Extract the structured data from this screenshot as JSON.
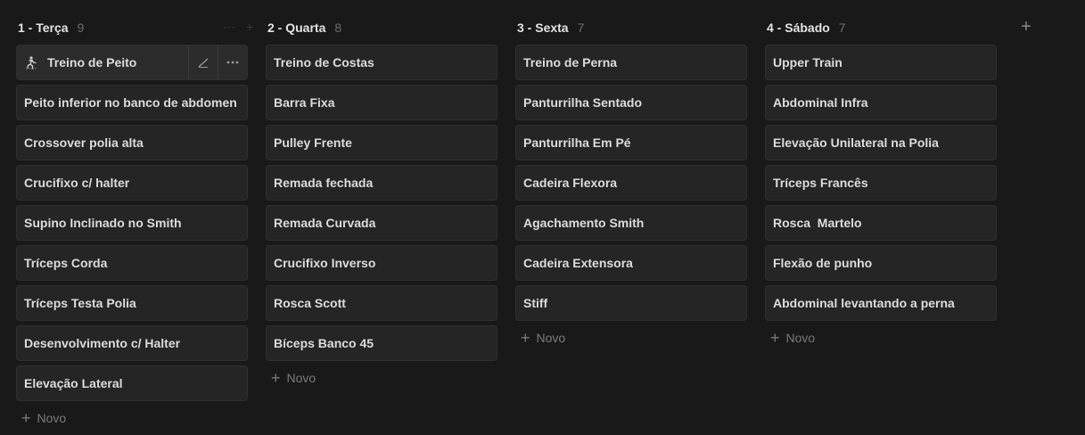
{
  "add_group_symbol": "+",
  "new_label": "Novo",
  "columns": [
    {
      "title": "1 - Terça",
      "count": "9",
      "cards": [
        "Treino de Peito",
        "Peito inferior no banco de abdomen",
        "Crossover polia alta",
        "Crucifixo c/ halter",
        "Supino Inclinado no Smith",
        "Tríceps Corda",
        "Tríceps Testa Polia",
        "Desenvolvimento c/ Halter",
        "Elevação Lateral"
      ]
    },
    {
      "title": "2 - Quarta",
      "count": "8",
      "cards": [
        "Treino de Costas",
        "Barra Fixa",
        "Pulley Frente",
        "Remada fechada",
        "Remada Curvada",
        "Crucifixo Inverso",
        "Rosca Scott",
        "Bíceps Banco 45"
      ]
    },
    {
      "title": "3 - Sexta",
      "count": "7",
      "cards": [
        "Treino de Perna",
        "Panturrilha Sentado",
        "Panturrilha Em Pé",
        "Cadeira Flexora",
        "Agachamento Smith",
        "Cadeira Extensora",
        "Stiff"
      ]
    },
    {
      "title": "4 - Sábado",
      "count": "7",
      "cards": [
        "Upper Train",
        "Abdominal Infra",
        "Elevação Unilateral na Polia",
        "Tríceps Francês",
        "Rosca  Martelo",
        "Flexão de punho",
        "Abdominal levantando a perna"
      ]
    }
  ]
}
